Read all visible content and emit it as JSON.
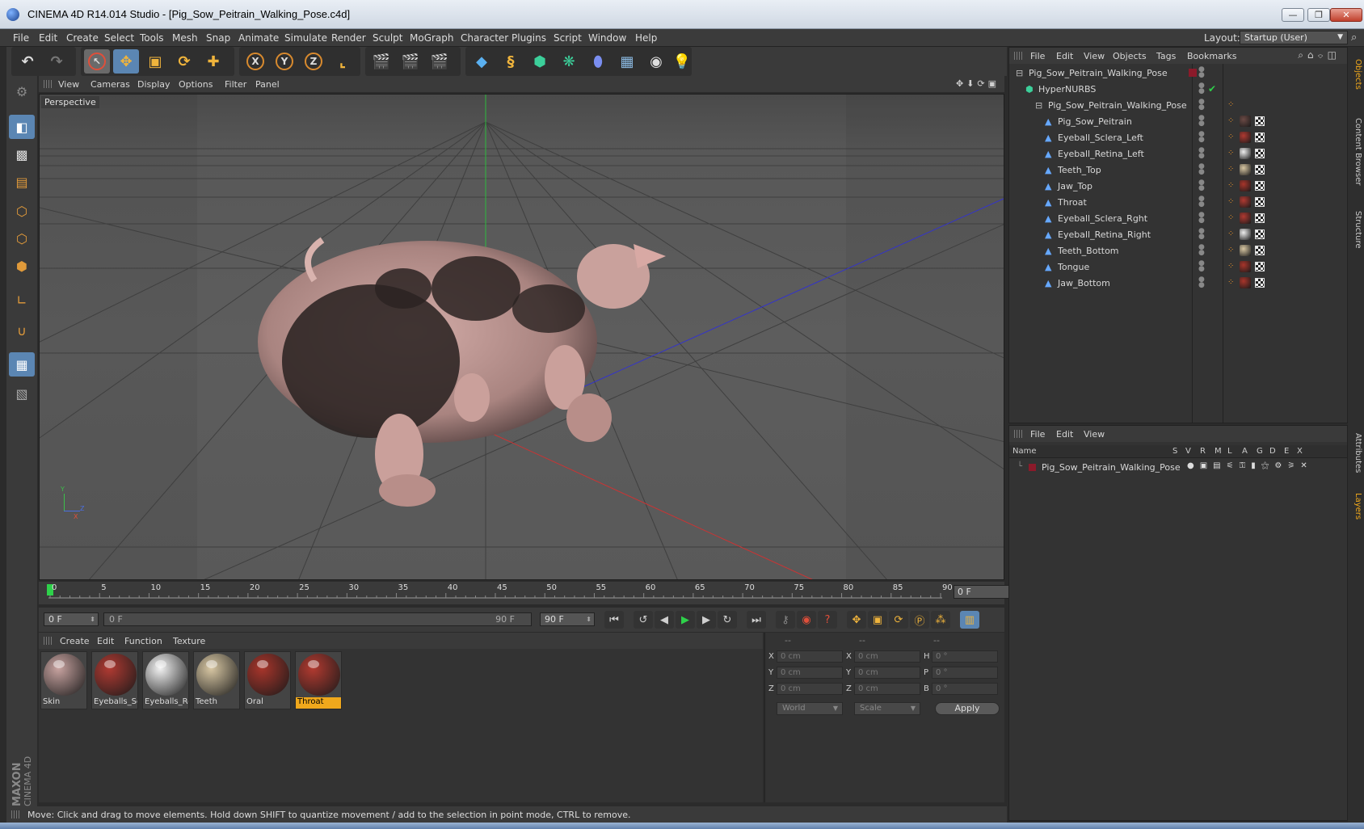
{
  "window": {
    "title": "CINEMA 4D R14.014 Studio - [Pig_Sow_Peitrain_Walking_Pose.c4d]",
    "minimize": "—",
    "restore": "❐",
    "close": "✕"
  },
  "menubar": {
    "items": [
      "File",
      "Edit",
      "Create",
      "Select",
      "Tools",
      "Mesh",
      "Snap",
      "Animate",
      "Simulate",
      "Render",
      "Sculpt",
      "MoGraph",
      "Character",
      "Plugins",
      "Script",
      "Window",
      "Help"
    ],
    "layout_label": "Layout:",
    "layout_value": "Startup (User)"
  },
  "toolbar": {
    "undo_glyph": "↶",
    "redo_glyph": "↷",
    "axis_x": "X",
    "axis_y": "Y",
    "axis_z": "Z"
  },
  "viewport": {
    "menu": [
      "View",
      "Cameras",
      "Display",
      "Options",
      "Filter",
      "Panel"
    ],
    "label": "Perspective",
    "nav_icons": "✥⬇⟳▣",
    "axis_y": "Y",
    "axis_z": "Z",
    "axis_x": "X"
  },
  "timeline": {
    "ticks": [
      "0",
      "5",
      "10",
      "15",
      "20",
      "25",
      "30",
      "35",
      "40",
      "45",
      "50",
      "55",
      "60",
      "65",
      "70",
      "75",
      "80",
      "85",
      "90"
    ],
    "current_frame": "0 F",
    "start_field": "0 F",
    "range_start": "0 F",
    "range_end": "90 F",
    "end_field": "90 F"
  },
  "materials": {
    "menu": [
      "Create",
      "Edit",
      "Function",
      "Texture"
    ],
    "items": [
      {
        "label": "Skin",
        "color": "#c8a3a0"
      },
      {
        "label": "Eyeballs_Sc",
        "color": "#b03a32"
      },
      {
        "label": "Eyeballs_Re",
        "color": "#f2f2f2"
      },
      {
        "label": "Teeth",
        "color": "#d8c7a3"
      },
      {
        "label": "Oral",
        "color": "#a8352b"
      },
      {
        "label": "Throat",
        "color": "#b23a30"
      }
    ],
    "selected": "Throat"
  },
  "coordinates": {
    "headers": [
      "--",
      "--",
      "--"
    ],
    "rows": [
      {
        "a": "X",
        "av": "0 cm",
        "b": "X",
        "bv": "0 cm",
        "c": "H",
        "cv": "0 °"
      },
      {
        "a": "Y",
        "av": "0 cm",
        "b": "Y",
        "bv": "0 cm",
        "c": "P",
        "cv": "0 °"
      },
      {
        "a": "Z",
        "av": "0 cm",
        "b": "Z",
        "bv": "0 cm",
        "c": "B",
        "cv": "0 °"
      }
    ],
    "mode": "World",
    "scale": "Scale",
    "apply": "Apply"
  },
  "object_manager": {
    "menu": [
      "File",
      "Edit",
      "View",
      "Objects",
      "Tags",
      "Bookmarks"
    ],
    "objects": [
      {
        "name": "Pig_Sow_Peitrain_Walking_Pose",
        "level": 0,
        "icon": "null"
      },
      {
        "name": "HyperNURBS",
        "level": 1,
        "icon": "nurbs"
      },
      {
        "name": "Pig_Sow_Peitrain_Walking_Pose",
        "level": 2,
        "icon": "null"
      },
      {
        "name": "Pig_Sow_Peitrain",
        "level": 3,
        "icon": "poly",
        "mat": "#6b4a45"
      },
      {
        "name": "Eyeball_Sclera_Left",
        "level": 3,
        "icon": "poly",
        "mat": "#b03a32"
      },
      {
        "name": "Eyeball_Retina_Left",
        "level": 3,
        "icon": "poly",
        "mat": "#eeeeee"
      },
      {
        "name": "Teeth_Top",
        "level": 3,
        "icon": "poly",
        "mat": "#d8c7a3"
      },
      {
        "name": "Jaw_Top",
        "level": 3,
        "icon": "poly",
        "mat": "#a8352b"
      },
      {
        "name": "Throat",
        "level": 3,
        "icon": "poly",
        "mat": "#b03a32"
      },
      {
        "name": "Eyeball_Sclera_Rght",
        "level": 3,
        "icon": "poly",
        "mat": "#b03a32"
      },
      {
        "name": "Eyeball_Retina_Right",
        "level": 3,
        "icon": "poly",
        "mat": "#eeeeee"
      },
      {
        "name": "Teeth_Bottom",
        "level": 3,
        "icon": "poly",
        "mat": "#d8c7a3"
      },
      {
        "name": "Tongue",
        "level": 3,
        "icon": "poly",
        "mat": "#a8352b"
      },
      {
        "name": "Jaw_Bottom",
        "level": 3,
        "icon": "poly",
        "mat": "#a8352b"
      }
    ]
  },
  "layer_manager": {
    "menu": [
      "File",
      "Edit",
      "View"
    ],
    "columns": [
      "Name",
      "S",
      "V",
      "R",
      "M",
      "L",
      "A",
      "G",
      "D",
      "E",
      "X"
    ],
    "layers": [
      {
        "name": "Pig_Sow_Peitrain_Walking_Pose",
        "color": "#8b1a2a"
      }
    ]
  },
  "side_tabs": {
    "top": [
      "Objects",
      "Content Browser",
      "Structure"
    ],
    "bottom": [
      "Attributes",
      "Layers"
    ]
  },
  "status": {
    "text": "Move: Click and drag to move elements. Hold down SHIFT to quantize movement / add to the selection in point mode, CTRL to remove."
  },
  "brand": {
    "maxon": "MAXON",
    "cinema": "CINEMA 4D"
  }
}
